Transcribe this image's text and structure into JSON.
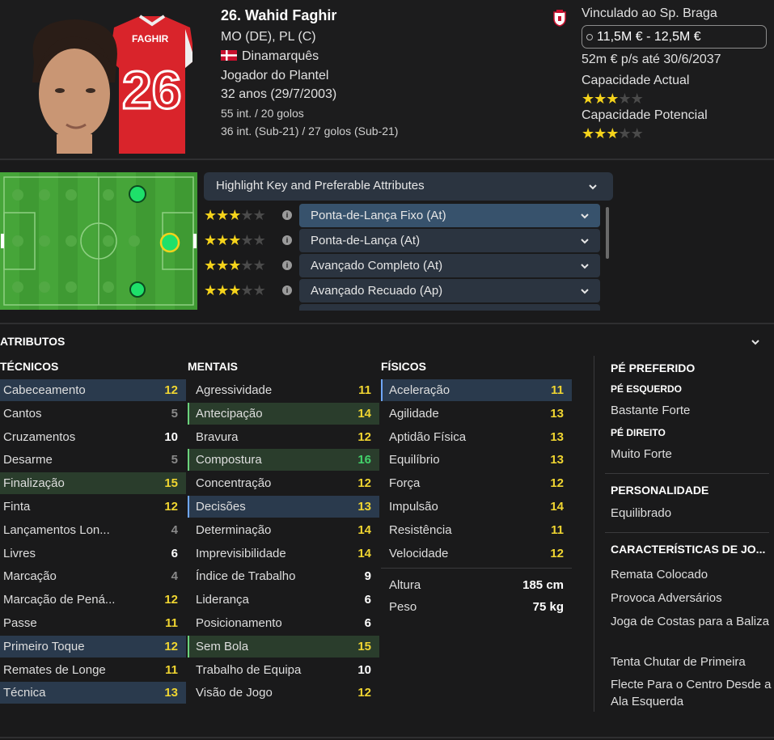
{
  "player": {
    "name": "26. Wahid Faghir",
    "shirt_name": "FAGHIR",
    "shirt_number": "26",
    "positions": "MO (DE), PL (C)",
    "nationality": "Dinamarquês",
    "squad_status": "Jogador do Plantel",
    "age": "32 anos (29/7/2003)",
    "caps": "55 int. / 20 golos",
    "u21_caps": "36 int. (Sub-21) / 27 golos (Sub-21)"
  },
  "club": {
    "contract_label": "Vinculado ao Sp. Braga",
    "value_range": "11,5M € - 12,5M €",
    "wage": "52m € p/s até 30/6/2037",
    "current_ability_label": "Capacidade Actual",
    "current_ability_stars": 3,
    "potential_ability_label": "Capacidade Potencial",
    "potential_ability_stars": 3
  },
  "roles": {
    "highlight_label": "Highlight Key and Preferable Attributes",
    "items": [
      {
        "label": "Ponta-de-Lança Fixo (At)",
        "stars": 3,
        "selected": true
      },
      {
        "label": "Ponta-de-Lança (At)",
        "stars": 3,
        "selected": false
      },
      {
        "label": "Avançado Completo (At)",
        "stars": 3,
        "selected": false
      },
      {
        "label": "Avançado Recuado (Ap)",
        "stars": 3,
        "selected": false
      }
    ]
  },
  "attributes": {
    "title": "ATRIBUTOS",
    "technical_header": "TÉCNICOS",
    "mental_header": "MENTAIS",
    "physical_header": "FÍSICOS",
    "technical": [
      {
        "name": "Cabeceamento",
        "value": "12",
        "hl": "key"
      },
      {
        "name": "Cantos",
        "value": "5",
        "hl": ""
      },
      {
        "name": "Cruzamentos",
        "value": "10",
        "hl": ""
      },
      {
        "name": "Desarme",
        "value": "5",
        "hl": ""
      },
      {
        "name": "Finalização",
        "value": "15",
        "hl": "pref"
      },
      {
        "name": "Finta",
        "value": "12",
        "hl": ""
      },
      {
        "name": "Lançamentos Lon...",
        "value": "4",
        "hl": ""
      },
      {
        "name": "Livres",
        "value": "6",
        "hl": ""
      },
      {
        "name": "Marcação",
        "value": "4",
        "hl": ""
      },
      {
        "name": "Marcação de Pená...",
        "value": "12",
        "hl": ""
      },
      {
        "name": "Passe",
        "value": "11",
        "hl": ""
      },
      {
        "name": "Primeiro Toque",
        "value": "12",
        "hl": "key"
      },
      {
        "name": "Remates de Longe",
        "value": "11",
        "hl": ""
      },
      {
        "name": "Técnica",
        "value": "13",
        "hl": "key"
      }
    ],
    "mental": [
      {
        "name": "Agressividade",
        "value": "11",
        "hl": ""
      },
      {
        "name": "Antecipação",
        "value": "14",
        "hl": "pref-mark"
      },
      {
        "name": "Bravura",
        "value": "12",
        "hl": ""
      },
      {
        "name": "Compostura",
        "value": "16",
        "hl": "pref-mark"
      },
      {
        "name": "Concentração",
        "value": "12",
        "hl": ""
      },
      {
        "name": "Decisões",
        "value": "13",
        "hl": "key-mark"
      },
      {
        "name": "Determinação",
        "value": "14",
        "hl": ""
      },
      {
        "name": "Imprevisibilidade",
        "value": "14",
        "hl": ""
      },
      {
        "name": "Índice de Trabalho",
        "value": "9",
        "hl": ""
      },
      {
        "name": "Liderança",
        "value": "6",
        "hl": ""
      },
      {
        "name": "Posicionamento",
        "value": "6",
        "hl": ""
      },
      {
        "name": "Sem Bola",
        "value": "15",
        "hl": "pref-mark"
      },
      {
        "name": "Trabalho de Equipa",
        "value": "10",
        "hl": ""
      },
      {
        "name": "Visão de Jogo",
        "value": "12",
        "hl": ""
      }
    ],
    "physical": [
      {
        "name": "Aceleração",
        "value": "11",
        "hl": "key-mark"
      },
      {
        "name": "Agilidade",
        "value": "13",
        "hl": ""
      },
      {
        "name": "Aptidão Física",
        "value": "13",
        "hl": ""
      },
      {
        "name": "Equilíbrio",
        "value": "13",
        "hl": ""
      },
      {
        "name": "Força",
        "value": "12",
        "hl": ""
      },
      {
        "name": "Impulsão",
        "value": "14",
        "hl": ""
      },
      {
        "name": "Resistência",
        "value": "11",
        "hl": ""
      },
      {
        "name": "Velocidade",
        "value": "12",
        "hl": ""
      }
    ],
    "height_label": "Altura",
    "height_value": "185 cm",
    "weight_label": "Peso",
    "weight_value": "75 kg"
  },
  "side": {
    "foot_header": "PÉ PREFERIDO",
    "left_foot_label": "PÉ ESQUERDO",
    "left_foot_value": "Bastante Forte",
    "right_foot_label": "PÉ DIREITO",
    "right_foot_value": "Muito Forte",
    "personality_header": "PERSONALIDADE",
    "personality_value": "Equilibrado",
    "traits_header": "CARACTERÍSTICAS DE JO...",
    "traits": [
      "Remata Colocado",
      "Provoca Adversários",
      "Joga de Costas para a Baliza",
      "Tenta Chutar de Primeira",
      "Flecte Para o Centro Desde a Ala Esquerda"
    ]
  },
  "colors": {
    "accent_yellow": "#f0d531",
    "accent_green": "#42d26b",
    "key_bg": "#2a3a4d",
    "pref_bg": "#2a3d2c",
    "pitch": "#3f9a33"
  },
  "icons": [
    "flag-denmark-icon",
    "club-badge-icon",
    "value-icon",
    "chevron-down-icon",
    "info-icon",
    "star-icon"
  ]
}
